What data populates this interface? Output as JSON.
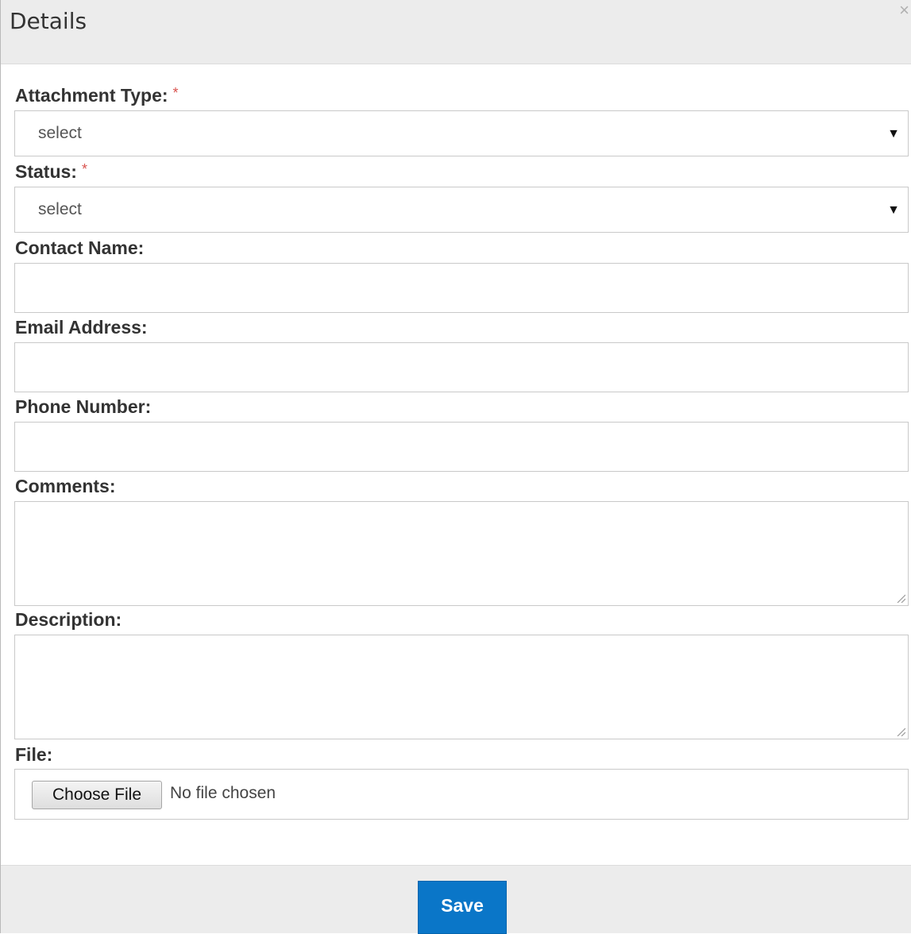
{
  "dialog": {
    "title": "Details",
    "close_glyph": "×"
  },
  "form": {
    "attachment_type": {
      "label": "Attachment Type:",
      "required_mark": "*",
      "value": "select",
      "caret": "▼"
    },
    "status": {
      "label": "Status:",
      "required_mark": "*",
      "value": "select",
      "caret": "▼"
    },
    "contact_name": {
      "label": "Contact Name:",
      "value": ""
    },
    "email_address": {
      "label": "Email Address:",
      "value": ""
    },
    "phone_number": {
      "label": "Phone Number:",
      "value": ""
    },
    "comments": {
      "label": "Comments:",
      "value": ""
    },
    "description": {
      "label": "Description:",
      "value": ""
    },
    "file": {
      "label": "File:",
      "button_label": "Choose File",
      "status": "No file chosen"
    }
  },
  "footer": {
    "save_label": "Save"
  },
  "colors": {
    "accent": "#0a76c8",
    "required": "#d9534f",
    "header_bg": "#ececec"
  },
  "icons": {
    "close": "close-icon",
    "caret": "chevron-down-icon",
    "resize": "resize-grip-icon"
  }
}
